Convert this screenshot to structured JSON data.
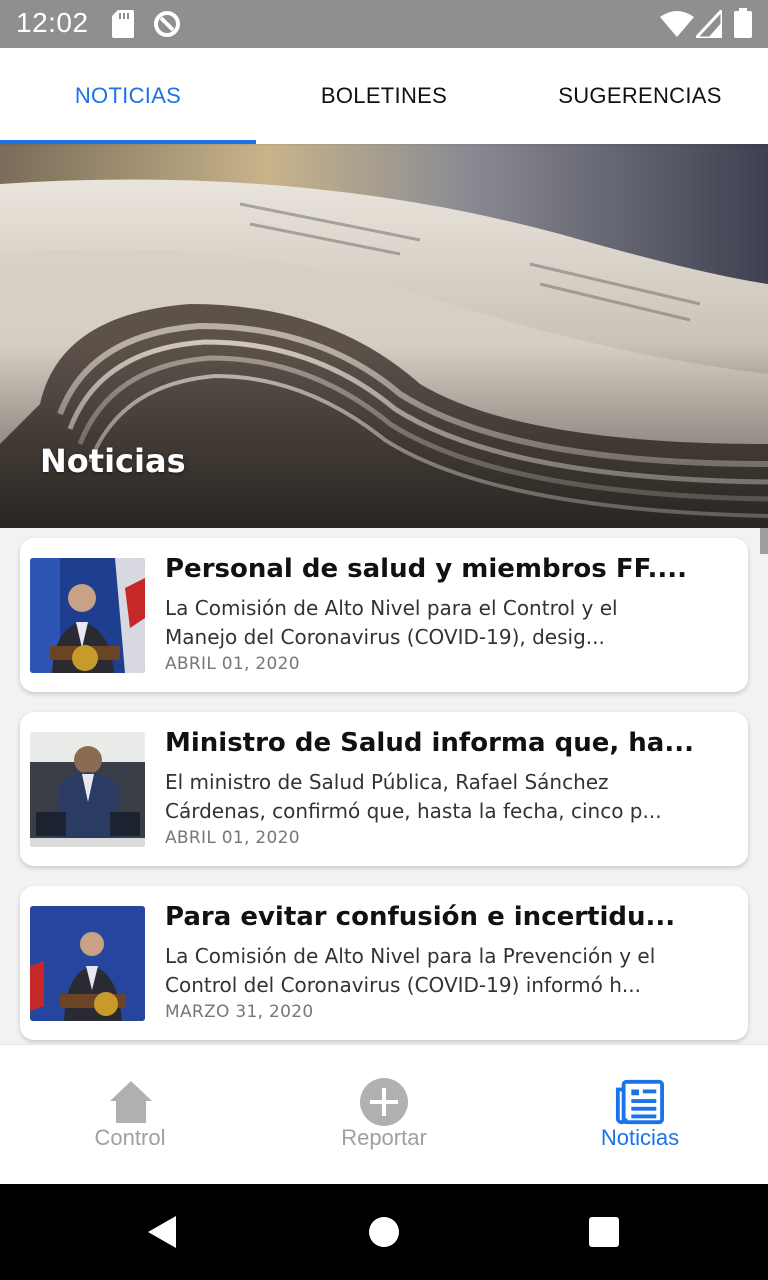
{
  "status_bar": {
    "time": "12:02",
    "icons": [
      "sd-card-icon",
      "sync-icon",
      "wifi-icon",
      "signal-icon",
      "battery-icon"
    ]
  },
  "tabs": [
    {
      "label": "NOTICIAS",
      "active": true
    },
    {
      "label": "BOLETINES",
      "active": false
    },
    {
      "label": "SUGERENCIAS",
      "active": false
    }
  ],
  "hero": {
    "title": "Noticias"
  },
  "news": [
    {
      "title": "Personal de salud y miembros FF....",
      "description": "La Comisión de Alto Nivel para el Control y el Manejo del Coronavirus (COVID-19), desig...",
      "date": "ABRIL 01, 2020"
    },
    {
      "title": "Ministro de Salud informa que, ha...",
      "description": "El ministro de Salud Pública, Rafael Sánchez Cárdenas, confirmó que, hasta la fecha, cinco p...",
      "date": "ABRIL 01, 2020"
    },
    {
      "title": "Para evitar confusión e incertidu...",
      "description": "La Comisión de Alto Nivel para la Prevención y el Control del Coronavirus (COVID-19) informó h...",
      "date": "MARZO 31, 2020"
    }
  ],
  "bottom_nav": [
    {
      "label": "Control",
      "icon": "home-icon",
      "active": false
    },
    {
      "label": "Reportar",
      "icon": "add-circle-icon",
      "active": false
    },
    {
      "label": "Noticias",
      "icon": "newspaper-icon",
      "active": true
    }
  ],
  "colors": {
    "accent": "#1a73e8",
    "inactive": "#a0a0a0",
    "status_bar": "#8f8f8f"
  }
}
